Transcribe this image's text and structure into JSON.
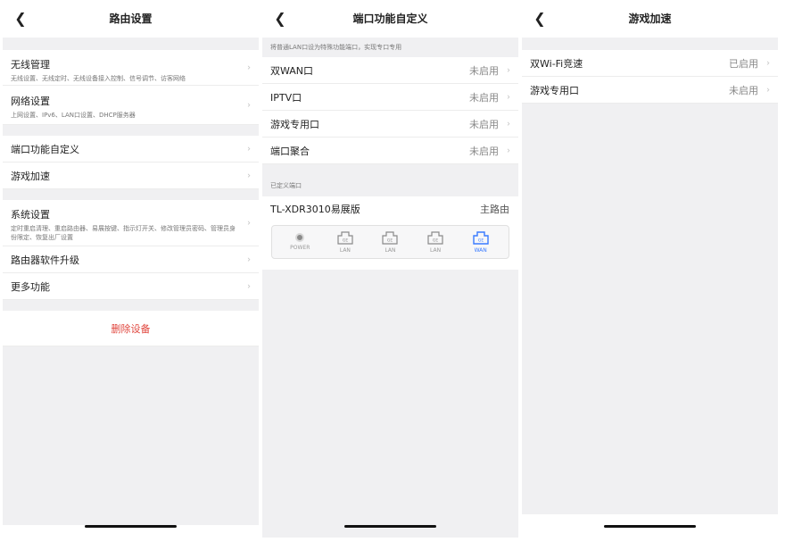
{
  "screen1": {
    "title": "路由设置",
    "items": [
      {
        "label": "无线管理",
        "sub": "无线设置、无线定时、无线设备接入控制、信号调节、访客网络"
      },
      {
        "label": "网络设置",
        "sub": "上网设置、IPv6、LAN口设置、DHCP服务器"
      },
      {
        "label": "端口功能自定义"
      },
      {
        "label": "游戏加速"
      },
      {
        "label": "系统设置",
        "sub": "定时重启清理、重启路由器、易展按键、指示灯开关、修改管理员密码、管理员身份限定、恢复出厂设置"
      },
      {
        "label": "路由器软件升级"
      },
      {
        "label": "更多功能"
      }
    ],
    "delete_label": "删除设备"
  },
  "screen2": {
    "title": "端口功能自定义",
    "hint": "将普通LAN口设为特殊功能端口，实现专口专用",
    "items": [
      {
        "label": "双WAN口",
        "status": "未启用"
      },
      {
        "label": "IPTV口",
        "status": "未启用"
      },
      {
        "label": "游戏专用口",
        "status": "未启用"
      },
      {
        "label": "端口聚合",
        "status": "未启用"
      }
    ],
    "defined_header": "已定义端口",
    "device_name": "TL-XDR3010易展版",
    "device_role": "主路由",
    "ports": [
      {
        "label": "POWER",
        "icon": "power-led-icon"
      },
      {
        "label": "LAN",
        "badge": "GE",
        "icon": "ethernet-port-icon"
      },
      {
        "label": "LAN",
        "badge": "GE",
        "icon": "ethernet-port-icon"
      },
      {
        "label": "LAN",
        "badge": "GE",
        "icon": "ethernet-port-icon"
      },
      {
        "label": "WAN",
        "badge": "GE",
        "icon": "ethernet-port-icon",
        "color": "#3a7bff"
      }
    ]
  },
  "screen3": {
    "title": "游戏加速",
    "items": [
      {
        "label": "双Wi-Fi竞速",
        "status": "已启用"
      },
      {
        "label": "游戏专用口",
        "status": "未启用"
      }
    ]
  },
  "colors": {
    "accent": "#3a7bff",
    "danger": "#e0453d",
    "background": "#f0f0f2"
  }
}
